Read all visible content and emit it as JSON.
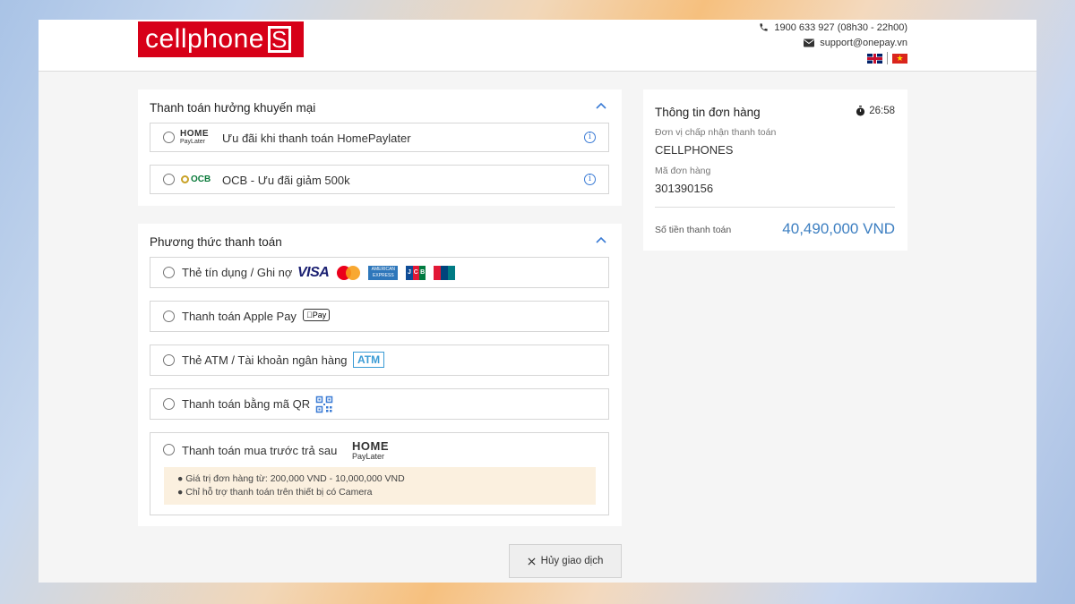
{
  "header": {
    "logo_text": "cellphone",
    "logo_s": "S",
    "phone": "1900 633 927 (08h30 - 22h00)",
    "email": "support@onepay.vn",
    "icons": [
      "phone-icon",
      "envelope-icon",
      "uk-flag-icon",
      "vn-flag-icon"
    ]
  },
  "promo": {
    "title": "Thanh toán hưởng khuyến mại",
    "options": [
      {
        "brand_top": "HOME",
        "brand_bottom": "PayLater",
        "label": "Ưu đãi khi thanh toán HomePaylater"
      },
      {
        "brand": "OCB",
        "label": "OCB - Ưu đãi giảm 500k"
      }
    ]
  },
  "methods": {
    "title": "Phương thức thanh toán",
    "options": [
      {
        "label": "Thẻ tín dụng / Ghi nợ",
        "card_brands": [
          "VISA",
          "Mastercard",
          "American Express",
          "JCB",
          "UnionPay"
        ]
      },
      {
        "label": "Thanh toán Apple Pay",
        "badge": "Pay"
      },
      {
        "label": "Thẻ ATM / Tài khoản ngân hàng",
        "badge": "ATM"
      },
      {
        "label": "Thanh toán bằng mã QR"
      },
      {
        "label": "Thanh toán mua trước trả sau",
        "brand_top": "HOME",
        "brand_bottom": "PayLater",
        "notes": [
          "● Giá trị đơn hàng từ: 200,000 VND - 10,000,000 VND",
          "● Chỉ hỗ trợ thanh toán trên thiết bị có Camera"
        ]
      }
    ]
  },
  "cancel_button": "Hủy giao dịch",
  "order": {
    "title": "Thông tin đơn hàng",
    "timer": "26:58",
    "merchant_label": "Đơn vị chấp nhận thanh toán",
    "merchant": "CELLPHONES",
    "order_id_label": "Mã đơn hàng",
    "order_id": "301390156",
    "amount_label": "Số tiền thanh toán",
    "amount": "40,490,000 VND"
  },
  "colors": {
    "brand_red": "#d70018",
    "accent_blue": "#3d7fc1",
    "note_bg": "#fbf0df"
  }
}
